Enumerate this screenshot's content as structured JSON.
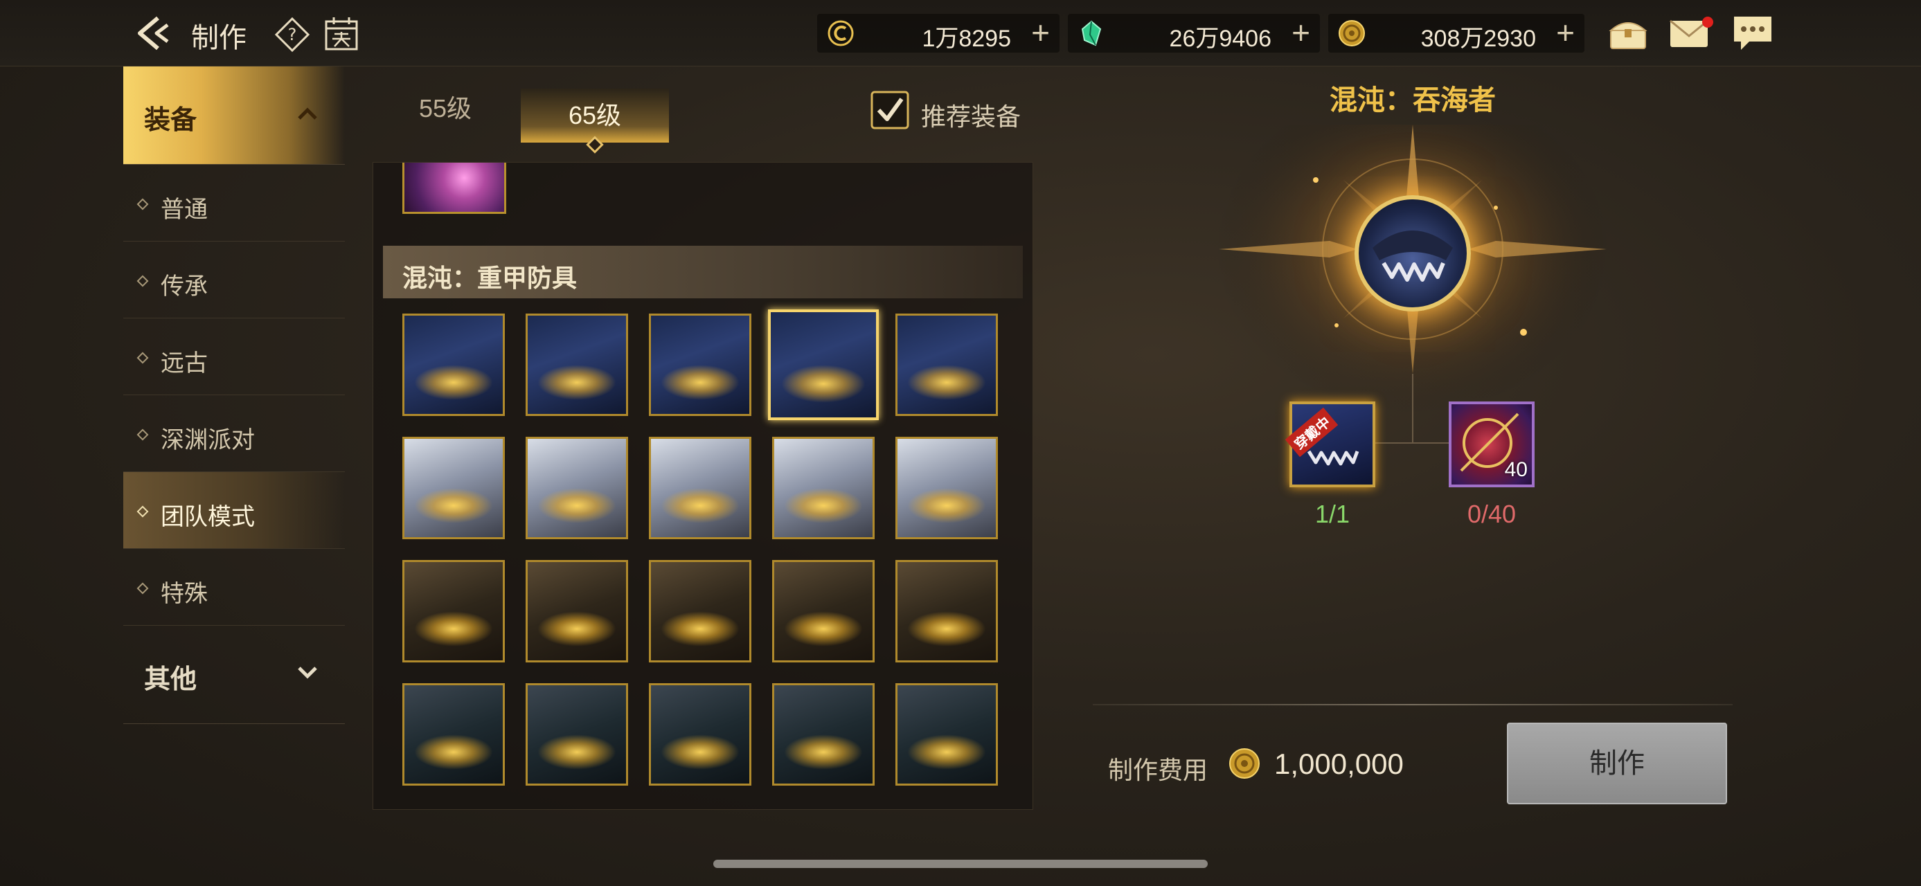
{
  "topbar": {
    "title": "制作",
    "currencies": [
      {
        "icon": "c-coin-icon",
        "value": "1万8295"
      },
      {
        "icon": "green-gem-icon",
        "value": "26万9406"
      },
      {
        "icon": "gold-coin-icon",
        "value": "308万2930"
      }
    ],
    "plus": "+"
  },
  "menu": {
    "categories": [
      {
        "label": "装备",
        "expanded": true
      },
      {
        "label": "其他",
        "expanded": false
      }
    ],
    "sub_items": [
      {
        "label": "普通"
      },
      {
        "label": "传承"
      },
      {
        "label": "远古"
      },
      {
        "label": "深渊派对"
      },
      {
        "label": "团队模式",
        "active": true
      },
      {
        "label": "特殊"
      }
    ]
  },
  "level_tabs": [
    {
      "label": "55级"
    },
    {
      "label": "65级",
      "active": true
    }
  ],
  "recommend": {
    "label": "推荐装备",
    "checked": true
  },
  "section": {
    "title": "混沌：重甲防具"
  },
  "detail": {
    "title": "混沌：吞海者",
    "materials": [
      {
        "tag": "穿戴中",
        "count": "1/1"
      },
      {
        "qty": "40",
        "count": "0/40"
      }
    ],
    "cost_label": "制作费用",
    "cost_value": "1,000,000",
    "craft_button": "制作"
  },
  "colors": {
    "accent_gold": "#f0c24a",
    "have_enough": "#8ad86a",
    "not_enough": "#e06a6a"
  }
}
